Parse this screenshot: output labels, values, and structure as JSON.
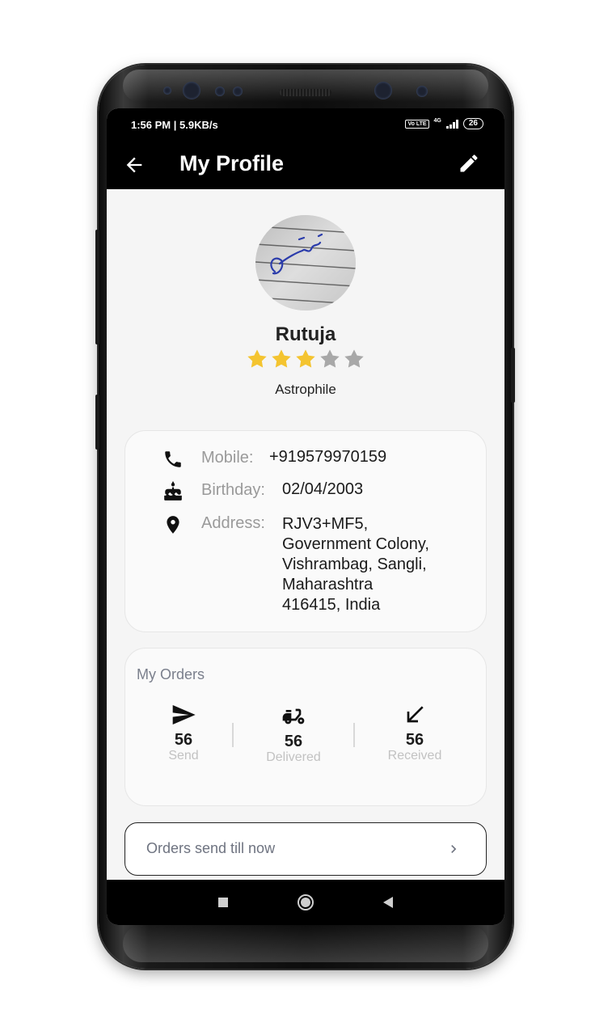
{
  "status_bar": {
    "time": "1:56 PM | 5.9KB/s",
    "volte": "Vo LTE",
    "network": "4G",
    "battery": "26"
  },
  "app_bar": {
    "title": "My Profile",
    "back_icon": "arrow-back-icon",
    "edit_icon": "pencil-icon"
  },
  "profile": {
    "name": "Rutuja",
    "rating": 3,
    "rating_max": 5,
    "tagline": "Astrophile",
    "avatar_signature": "Rutuja"
  },
  "details": [
    {
      "icon": "phone-icon",
      "label": "Mobile:",
      "value": "+919579970159"
    },
    {
      "icon": "cake-icon",
      "label": "Birthday:",
      "value": "02/04/2003"
    },
    {
      "icon": "location-pin-icon",
      "label": "Address:",
      "value_lines": [
        "RJV3+MF5,",
        "Government Colony,",
        "Vishrambag, Sangli,",
        "Maharashtra",
        "416415, India"
      ]
    }
  ],
  "orders": {
    "title": "My Orders",
    "stats": [
      {
        "icon": "send-icon",
        "value": "56",
        "label": "Send"
      },
      {
        "icon": "delivery-scooter-icon",
        "value": "56",
        "label": "Delivered"
      },
      {
        "icon": "arrow-down-left-icon",
        "value": "56",
        "label": "Received"
      }
    ]
  },
  "list_button": {
    "label": "Orders send till now",
    "icon": "chevron-right-icon"
  },
  "colors": {
    "star_active": "#F4C430",
    "star_inactive": "#A8A8A8",
    "bar_background": "#000000",
    "screen_background": "#F5F5F5"
  }
}
